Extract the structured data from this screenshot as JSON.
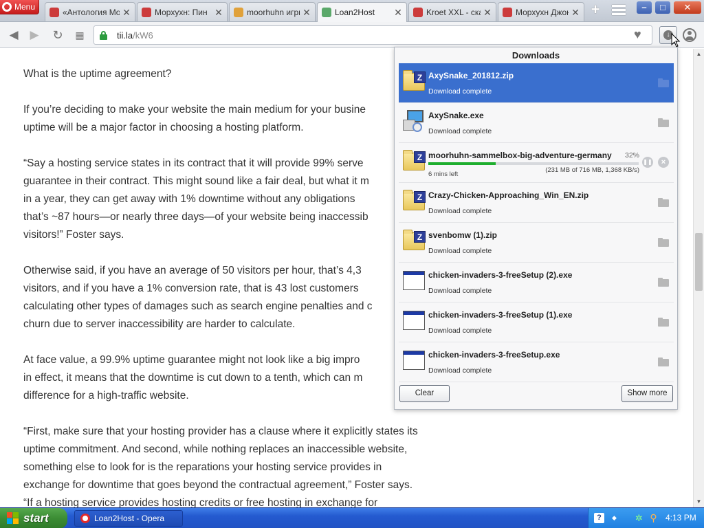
{
  "browser": {
    "menu_label": "Menu",
    "tabs": [
      {
        "label": "«Антология Mo",
        "favicon_color": "#cc3b3b",
        "active": false
      },
      {
        "label": "Морхухн: Пин",
        "favicon_color": "#cc3b3b",
        "active": false
      },
      {
        "label": "moorhuhn игры",
        "favicon_color": "#e0a13a",
        "active": false
      },
      {
        "label": "Loan2Host",
        "favicon_color": "#5aa86a",
        "active": true
      },
      {
        "label": "Kroet XXL - ска",
        "favicon_color": "#cc3b3b",
        "active": false
      },
      {
        "label": "Морхухн Джон",
        "favicon_color": "#cc3b3b",
        "active": false
      }
    ],
    "url_host": "tii.la",
    "url_path": "/kW6"
  },
  "article": {
    "paragraphs": [
      "What is the uptime agreement?",
      "If you’re deciding to make your website the main medium for your busine\nuptime will be a major factor in choosing a hosting platform.",
      "“Say a hosting service states in its contract that it will provide 99% serve\nguarantee in their contract. This might sound like a fair deal, but what it m\nin a year, they can get away with 1% downtime without any obligations\nthat’s ~87 hours—or nearly three days—of your website being inaccessib\nvisitors!” Foster says.",
      "Otherwise said, if you have an average of 50 visitors per hour, that’s 4,3\nvisitors, and if you have a 1% conversion rate, that is 43 lost customers\ncalculating other types of damages such as search engine penalties and c\nchurn due to server inaccessibility are harder to calculate.",
      "At face value, a 99.9% uptime guarantee might not look like a big impro\nin effect, it means that the downtime is cut down to a tenth, which can m\ndifference for a high-traffic website.",
      "“First, make sure that your hosting provider has a clause where it explicitly states its\nuptime commitment. And second, while nothing replaces an inaccessible website,\nsomething else to look for is the reparations your hosting service provides in\nexchange for downtime that goes beyond the contractual agreement,” Foster says.\n“If a hosting service provides hosting credits or free hosting in exchange for"
    ]
  },
  "downloads": {
    "title": "Downloads",
    "items": [
      {
        "name": "AxySnake_201812.zip",
        "status": "Download complete",
        "icon": "zip-folder-icon",
        "selected": true
      },
      {
        "name": "AxySnake.exe",
        "status": "Download complete",
        "icon": "setup-icon",
        "selected": false
      },
      {
        "name": "moorhuhn-sammelbox-big-adventure-germany",
        "status": "",
        "icon": "zip-folder-icon",
        "selected": false,
        "in_progress": true,
        "percent_label": "32%",
        "progress": 0.32,
        "time_left": "6 mins left",
        "bytes": "(231 MB of 716 MB, 1,368 KB/s)"
      },
      {
        "name": "Crazy-Chicken-Approaching_Win_EN.zip",
        "status": "Download complete",
        "icon": "zip-folder-icon",
        "selected": false
      },
      {
        "name": "svenbomw (1).zip",
        "status": "Download complete",
        "icon": "zip-folder-icon",
        "selected": false
      },
      {
        "name": "chicken-invaders-3-freeSetup (2).exe",
        "status": "Download complete",
        "icon": "exe-window-icon",
        "selected": false
      },
      {
        "name": "chicken-invaders-3-freeSetup (1).exe",
        "status": "Download complete",
        "icon": "exe-window-icon",
        "selected": false
      },
      {
        "name": "chicken-invaders-3-freeSetup.exe",
        "status": "Download complete",
        "icon": "exe-window-icon",
        "selected": false
      }
    ],
    "clear_label": "Clear",
    "show_more_label": "Show more"
  },
  "taskbar": {
    "start_label": "start",
    "task_label": "Loan2Host - Opera",
    "clock": "4:13 PM"
  },
  "colors": {
    "selected_row": "#3a6fce",
    "progress": "#1fae2e",
    "taskbar": "#245ad0",
    "start": "#3b8c34"
  }
}
